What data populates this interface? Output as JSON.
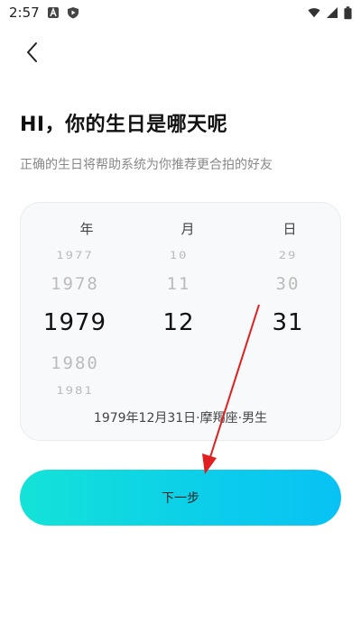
{
  "status_bar": {
    "time": "2:57"
  },
  "header": {
    "title": "HI，你的生日是哪天呢",
    "subtitle": "正确的生日将帮助系统为你推荐更合拍的好友"
  },
  "picker": {
    "columns": [
      {
        "label": "年",
        "items": [
          "1977",
          "1978",
          "1979",
          "1980",
          "1981"
        ],
        "selected": "1979"
      },
      {
        "label": "月",
        "items": [
          "10",
          "11",
          "12"
        ],
        "selected": "12"
      },
      {
        "label": "日",
        "items": [
          "29",
          "30",
          "31"
        ],
        "selected": "31"
      }
    ],
    "summary": "1979年12月31日·摩羯座·男生"
  },
  "actions": {
    "next_label": "下一步"
  },
  "colors": {
    "button_gradient_start": "#14e3d7",
    "button_gradient_end": "#08c2f5",
    "annotation_arrow": "#e02020"
  }
}
